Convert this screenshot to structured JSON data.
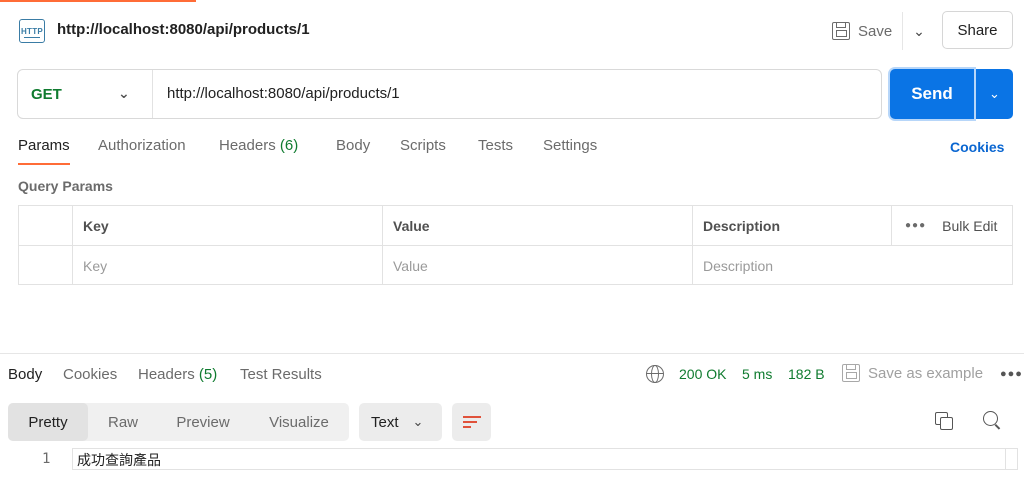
{
  "header": {
    "icon_text": "HTTP",
    "title": "http://localhost:8080/api/products/1",
    "save_label": "Save",
    "share_label": "Share"
  },
  "request": {
    "method": "GET",
    "url": "http://localhost:8080/api/products/1",
    "send_label": "Send"
  },
  "request_tabs": {
    "params": "Params",
    "authorization": "Authorization",
    "headers": "Headers",
    "headers_count": "(6)",
    "body": "Body",
    "scripts": "Scripts",
    "tests": "Tests",
    "settings": "Settings",
    "cookies": "Cookies"
  },
  "query_params": {
    "section_label": "Query Params",
    "columns": [
      "Key",
      "Value",
      "Description"
    ],
    "bulk_edit": "Bulk Edit",
    "placeholders": [
      "Key",
      "Value",
      "Description"
    ]
  },
  "response_tabs": {
    "body": "Body",
    "cookies": "Cookies",
    "headers": "Headers",
    "headers_count": "(5)",
    "test_results": "Test Results"
  },
  "response_status": {
    "status": "200 OK",
    "time": "5 ms",
    "size": "182 B",
    "save_example": "Save as example"
  },
  "response_toolbar": {
    "formats": [
      "Pretty",
      "Raw",
      "Preview",
      "Visualize"
    ],
    "active_format": "Pretty",
    "type": "Text"
  },
  "response_body": {
    "line_number": "1",
    "content": "成功查詢產品"
  },
  "colors": {
    "accent": "#ff6c37",
    "send_blue": "#0a74e5",
    "method_green": "#0f7b2f",
    "link_blue": "#0a66d1"
  }
}
